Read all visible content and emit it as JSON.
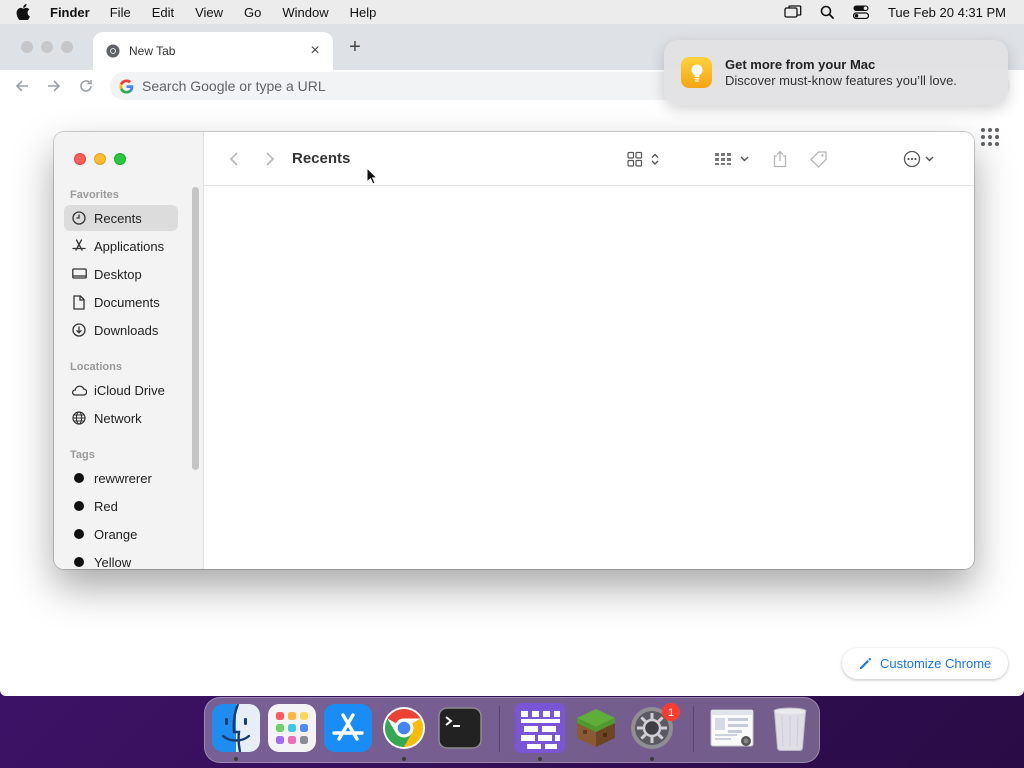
{
  "menubar": {
    "app_name": "Finder",
    "items": [
      "File",
      "Edit",
      "View",
      "Go",
      "Window",
      "Help"
    ],
    "clock": "Tue Feb 20  4:31 PM"
  },
  "chrome": {
    "tab_title": "New Tab",
    "omnibox_placeholder": "Search Google or type a URL",
    "customize_label": "Customize Chrome",
    "link_accent": "#1a73e8"
  },
  "notification": {
    "title": "Get more from your Mac",
    "body": "Discover must-know features you’ll love."
  },
  "finder": {
    "title": "Recents",
    "favorites_heading": "Favorites",
    "favorites": [
      {
        "label": "Recents",
        "icon": "clock-icon",
        "selected": true
      },
      {
        "label": "Applications",
        "icon": "applications-icon"
      },
      {
        "label": "Desktop",
        "icon": "desktop-icon"
      },
      {
        "label": "Documents",
        "icon": "document-icon"
      },
      {
        "label": "Downloads",
        "icon": "download-icon"
      }
    ],
    "locations_heading": "Locations",
    "locations": [
      {
        "label": "iCloud Drive",
        "icon": "cloud-icon"
      },
      {
        "label": "Network",
        "icon": "globe-icon"
      }
    ],
    "tags_heading": "Tags",
    "tags": [
      {
        "label": "rewwrerer"
      },
      {
        "label": "Red"
      },
      {
        "label": "Orange"
      },
      {
        "label": "Yellow"
      }
    ]
  },
  "dock": {
    "apps": [
      "finder-icon",
      "launchpad-icon",
      "app-store-icon",
      "chrome-icon",
      "terminal-icon",
      "castle-app-icon",
      "minecraft-icon",
      "system-settings-icon",
      "preview-icon",
      "trash-icon"
    ],
    "settings_badge": "1"
  }
}
